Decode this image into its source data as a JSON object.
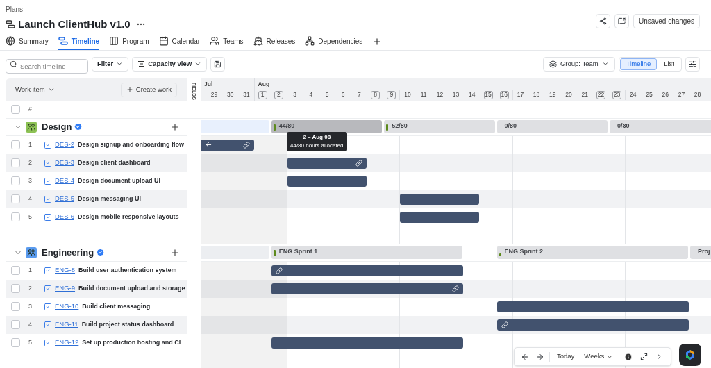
{
  "breadcrumb": "Plans",
  "title": "Launch ClientHub v1.0",
  "header_buttons": {
    "unsaved": "Unsaved changes"
  },
  "tabs": [
    {
      "label": "Summary",
      "selected": false
    },
    {
      "label": "Timeline",
      "selected": true
    },
    {
      "label": "Program",
      "selected": false
    },
    {
      "label": "Calendar",
      "selected": false
    },
    {
      "label": "Teams",
      "selected": false
    },
    {
      "label": "Releases",
      "selected": false
    },
    {
      "label": "Dependencies",
      "selected": false
    }
  ],
  "toolbar": {
    "search_placeholder": "Search timeline",
    "filter": "Filter",
    "capacity": "Capacity view",
    "group": "Group: Team",
    "views": [
      {
        "label": "Timeline",
        "selected": true
      },
      {
        "label": "List",
        "selected": false
      }
    ]
  },
  "list_header": {
    "work_item": "Work item",
    "create": "Create work",
    "number": "#",
    "fields": "FIELDS",
    "select_all_checked": false
  },
  "timeline": {
    "months": [
      {
        "label": "Jul"
      },
      {
        "label": "Aug"
      }
    ],
    "days": [
      {
        "label": "29",
        "weekend": false
      },
      {
        "label": "30",
        "weekend": false
      },
      {
        "label": "31",
        "weekend": false
      },
      {
        "label": "1",
        "weekend": true
      },
      {
        "label": "2",
        "weekend": true
      },
      {
        "label": "3",
        "weekend": false
      },
      {
        "label": "4",
        "weekend": false
      },
      {
        "label": "5",
        "weekend": false
      },
      {
        "label": "6",
        "weekend": false
      },
      {
        "label": "7",
        "weekend": false
      },
      {
        "label": "8",
        "weekend": true
      },
      {
        "label": "9",
        "weekend": true
      },
      {
        "label": "10",
        "weekend": false
      },
      {
        "label": "11",
        "weekend": false
      },
      {
        "label": "12",
        "weekend": false
      },
      {
        "label": "13",
        "weekend": false
      },
      {
        "label": "14",
        "weekend": false
      },
      {
        "label": "15",
        "weekend": true
      },
      {
        "label": "16",
        "weekend": true
      },
      {
        "label": "17",
        "weekend": false
      },
      {
        "label": "18",
        "weekend": false
      },
      {
        "label": "19",
        "weekend": false
      },
      {
        "label": "20",
        "weekend": false
      },
      {
        "label": "21",
        "weekend": false
      },
      {
        "label": "22",
        "weekend": true
      },
      {
        "label": "23",
        "weekend": true
      },
      {
        "label": "24",
        "weekend": false
      },
      {
        "label": "25",
        "weekend": false
      },
      {
        "label": "26",
        "weekend": false
      },
      {
        "label": "27",
        "weekend": false
      },
      {
        "label": "28",
        "weekend": false
      }
    ],
    "tooltip": {
      "title": "2 – Aug 08",
      "text": "44/80 hours allocated"
    }
  },
  "groups": [
    {
      "name": "Design",
      "color": "#8dc255",
      "expanded": true,
      "sprints": [
        {
          "kind": "blank",
          "color": "#e8f0fd"
        },
        {
          "kind": "allocated",
          "label": "44/80",
          "selected": true
        },
        {
          "kind": "allocated",
          "label": "52/80",
          "selected": false
        },
        {
          "kind": "empty",
          "label": "0/80",
          "selected": false
        },
        {
          "kind": "empty",
          "label": "0/80",
          "selected": false
        }
      ],
      "items": [
        {
          "number": "1",
          "key": "DES-2",
          "title": "Design signup and onboarding flow",
          "checked": false,
          "bar": {
            "link_at_start": false,
            "link_at_end": true,
            "continues_left": true
          }
        },
        {
          "number": "2",
          "key": "DES-3",
          "title": "Design client dashboard",
          "checked": false,
          "bar": {
            "link_at_start": false,
            "link_at_end": true,
            "continues_left": false
          }
        },
        {
          "number": "3",
          "key": "DES-4",
          "title": "Design document upload UI",
          "checked": false,
          "bar": {
            "link_at_start": false,
            "link_at_end": false,
            "continues_left": false
          }
        },
        {
          "number": "4",
          "key": "DES-5",
          "title": "Design messaging UI",
          "checked": false,
          "bar": {
            "link_at_start": false,
            "link_at_end": false,
            "continues_left": false
          }
        },
        {
          "number": "5",
          "key": "DES-6",
          "title": "Design mobile responsive layouts",
          "checked": false,
          "bar": {
            "link_at_start": false,
            "link_at_end": false,
            "continues_left": false
          }
        }
      ]
    },
    {
      "name": "Engineering",
      "color": "#5a9bef",
      "expanded": true,
      "sprints": [
        {
          "kind": "blank",
          "color": "#eceef1"
        },
        {
          "kind": "allocated",
          "label": "ENG Sprint 1",
          "selected": false
        },
        {
          "kind": "partial",
          "label": "ENG Sprint 2",
          "selected": false
        },
        {
          "kind": "empty",
          "label": "Proj",
          "selected": false
        }
      ],
      "items": [
        {
          "number": "1",
          "key": "ENG-8",
          "title": "Build user authentication system",
          "checked": false,
          "bar": {
            "link_at_start": true,
            "link_at_end": false,
            "continues_left": false
          }
        },
        {
          "number": "2",
          "key": "ENG-9",
          "title": "Build document upload and storage",
          "checked": false,
          "bar": {
            "link_at_start": false,
            "link_at_end": true,
            "continues_left": false
          }
        },
        {
          "number": "3",
          "key": "ENG-10",
          "title": "Build client messaging",
          "checked": false,
          "bar": {
            "link_at_start": false,
            "link_at_end": false,
            "continues_left": false
          }
        },
        {
          "number": "4",
          "key": "ENG-11",
          "title": "Build project status dashboard",
          "checked": false,
          "bar": {
            "link_at_start": true,
            "link_at_end": false,
            "continues_left": false
          }
        },
        {
          "number": "5",
          "key": "ENG-12",
          "title": "Set up production hosting and CI",
          "checked": false,
          "bar": {
            "link_at_start": false,
            "link_at_end": false,
            "continues_left": false
          }
        }
      ]
    }
  ],
  "bottom_bar": {
    "today": "Today",
    "scale": "Weeks"
  }
}
